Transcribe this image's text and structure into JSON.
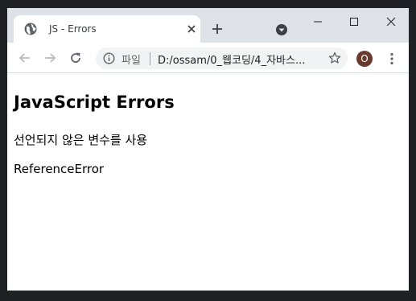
{
  "browser": {
    "tab": {
      "title": "JS - Errors",
      "icon": "globe-icon"
    },
    "window_controls": [
      "minimize-icon",
      "maximize-icon",
      "close-icon"
    ],
    "omnibox": {
      "chip_label": "파일",
      "url": "D:/ossam/0_웹코딩/4_자바스..."
    },
    "profile": {
      "initial": "O",
      "color": "#6b3a2f"
    }
  },
  "page": {
    "heading": "JavaScript Errors",
    "paragraph1": "선언되지 않은 변수를 사용",
    "paragraph2": "ReferenceError"
  }
}
